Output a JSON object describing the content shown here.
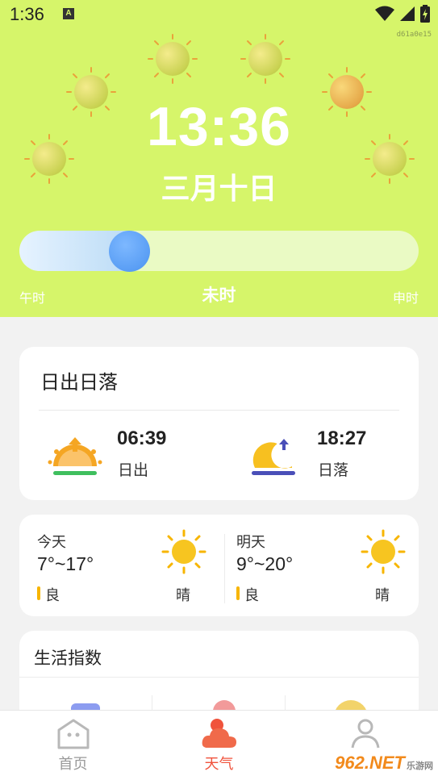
{
  "status_bar": {
    "time": "1:36",
    "notification_badge": "A"
  },
  "build_tag": "d61a0e15",
  "clock": {
    "time": "13:36",
    "date": "三月十日"
  },
  "hour_slider": {
    "previous": "午时",
    "current": "未时",
    "next": "申时",
    "progress": 0.25
  },
  "sunrise_sunset": {
    "title": "日出日落",
    "sunrise_time": "06:39",
    "sunrise_label": "日出",
    "sunset_time": "18:27",
    "sunset_label": "日落"
  },
  "forecast": [
    {
      "day": "今天",
      "temp": "7°~17°",
      "aqi": "良",
      "condition": "晴",
      "icon": "sunny-icon"
    },
    {
      "day": "明天",
      "temp": "9°~20°",
      "aqi": "良",
      "condition": "晴",
      "icon": "sunny-icon"
    }
  ],
  "life_index": {
    "title": "生活指数"
  },
  "nav": [
    {
      "label": "首页",
      "icon": "home-icon"
    },
    {
      "label": "天气",
      "icon": "weather-cloud-icon",
      "active": true
    },
    {
      "label": "",
      "icon": "profile-icon"
    }
  ],
  "watermark": {
    "text": "962.NET",
    "sub": "乐游网"
  },
  "colors": {
    "hero": "#d6f56a",
    "accent": "#f0533c",
    "aqi": "#f7b500",
    "knob": "#4b93f0"
  }
}
